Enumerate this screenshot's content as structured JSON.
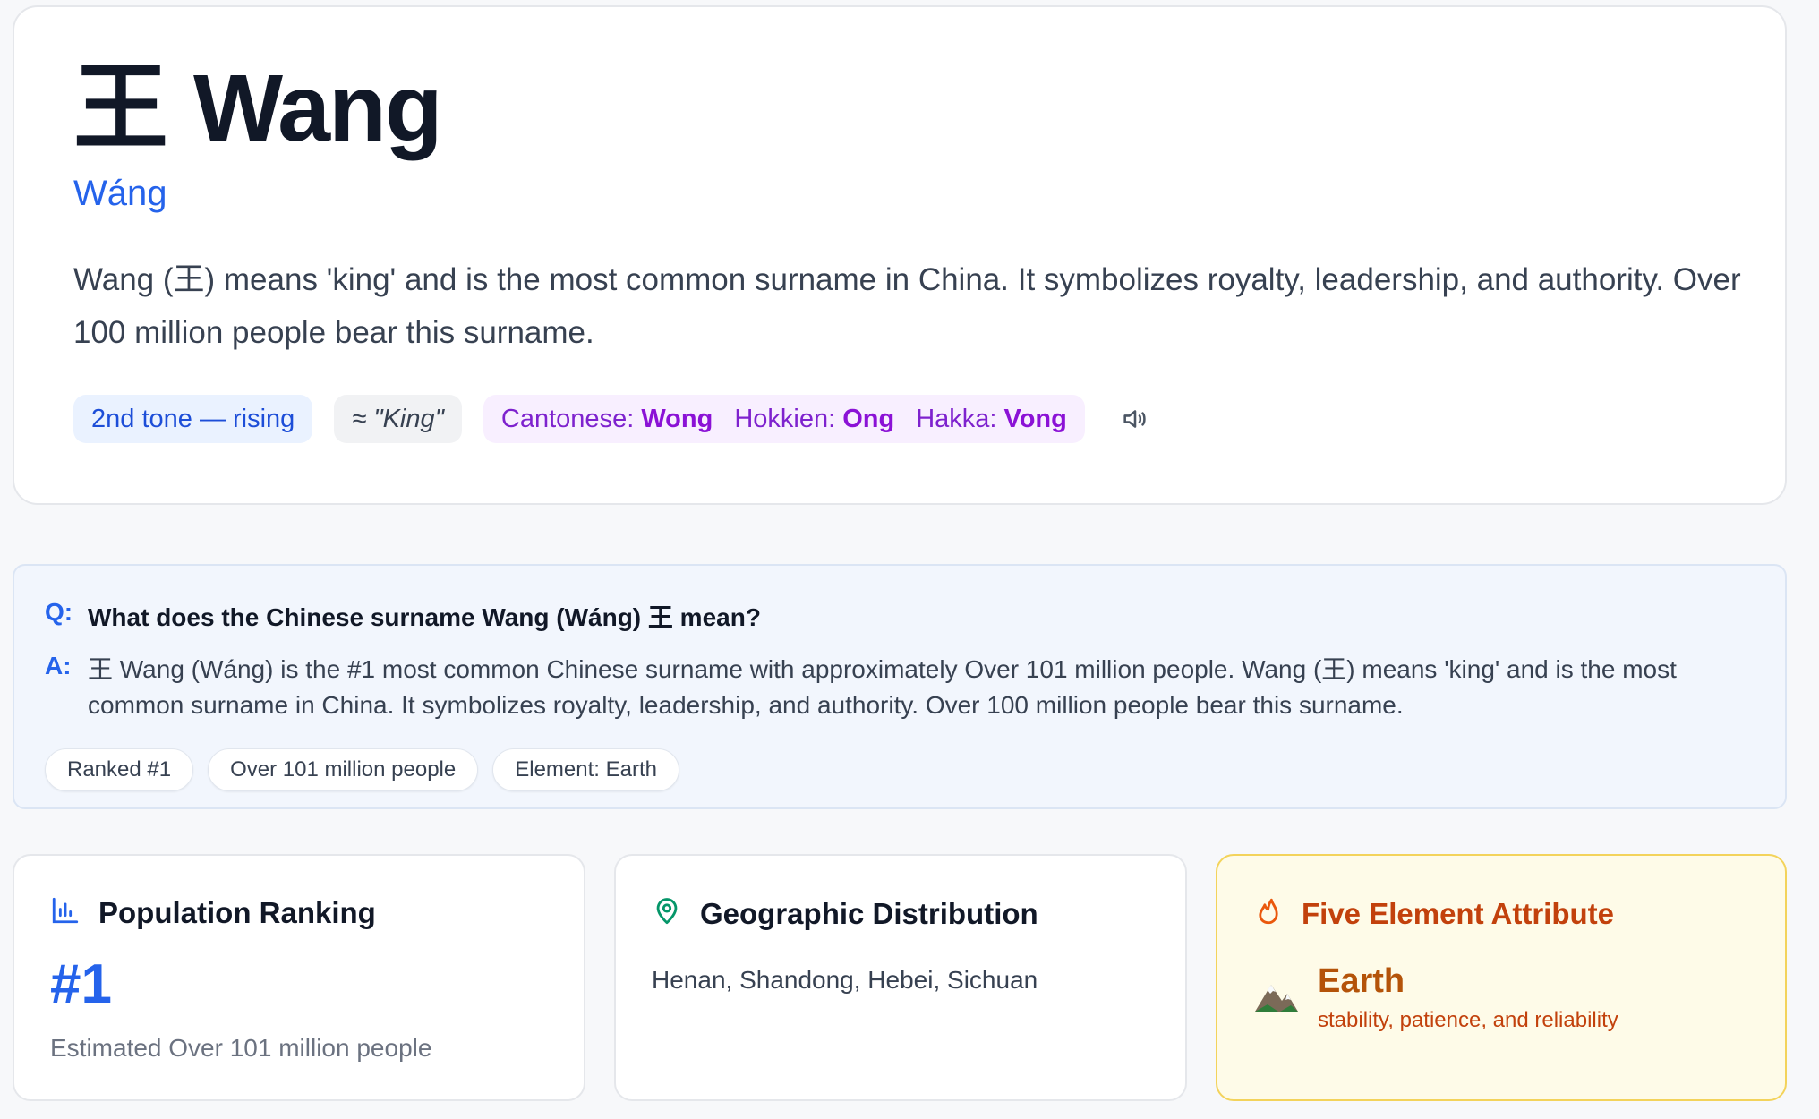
{
  "hero": {
    "character": "王",
    "name": "Wang",
    "pinyin": "Wáng",
    "description": "Wang (王) means 'king' and is the most common surname in China. It symbolizes royalty, leadership, and authority. Over 100 million people bear this surname.",
    "tone": "2nd tone — rising",
    "meaning": "≈ \"King\"",
    "dialects": [
      {
        "label": "Cantonese:",
        "value": "Wong"
      },
      {
        "label": "Hokkien:",
        "value": "Ong"
      },
      {
        "label": "Hakka:",
        "value": "Vong"
      }
    ],
    "speaker_icon": "speaker-icon"
  },
  "faq": {
    "q_prefix": "Q:",
    "question": "What does the Chinese surname Wang (Wáng) 王 mean?",
    "a_prefix": "A:",
    "answer": "王 Wang (Wáng) is the #1 most common Chinese surname with approximately Over 101 million people. Wang (王) means 'king' and is the most common surname in China. It symbolizes royalty, leadership, and authority. Over 100 million people bear this surname.",
    "pills": [
      "Ranked #1",
      "Over 101 million people",
      "Element: Earth"
    ]
  },
  "ranking": {
    "title": "Population Ranking",
    "icon": "bar-chart-icon",
    "rank": "#1",
    "estimate": "Estimated Over 101 million people"
  },
  "geography": {
    "title": "Geographic Distribution",
    "icon": "map-pin-icon",
    "regions": "Henan, Shandong, Hebei, Sichuan"
  },
  "element": {
    "title": "Five Element Attribute",
    "icon": "flame-icon",
    "emoji": "🏔️",
    "name": "Earth",
    "traits": "stability, patience, and reliability"
  },
  "colors": {
    "accent": "#2563eb",
    "dialect": "#7e22ce",
    "element": "#c2410c"
  }
}
